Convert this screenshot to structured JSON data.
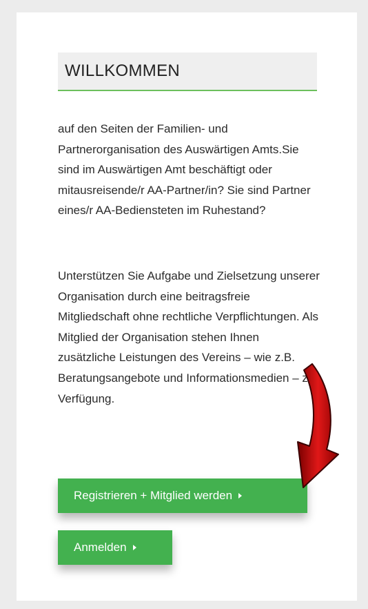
{
  "welcome": {
    "title": "WILLKOMMEN",
    "paragraph1": "auf den Seiten der Familien- und Partnerorganisation des Auswärtigen Amts.Sie sind im Auswärtigen Amt beschäftigt oder mitausreisende/r AA-Partner/in? Sie sind Partner eines/r AA-Bediensteten im Ruhestand?",
    "paragraph2": "Unterstützen Sie Aufgabe und Zielsetzung unserer Organisation durch eine beitragsfreie Mitgliedschaft ohne rechtliche Verpflichtungen. Als Mitglied der Organisation stehen Ihnen zusätzliche Leistungen des Vereins – wie z.B. Beratungsangebote und Informationsmedien – zur Verfügung."
  },
  "buttons": {
    "register_label": "Registrieren + Mitglied werden",
    "login_label": "Anmelden"
  },
  "icons": {
    "button_caret": "caret-right-icon",
    "annotation": "red-curved-arrow-icon"
  },
  "colors": {
    "accent_green": "#43b14f",
    "title_underline": "#6cbf5c",
    "arrow_red": "#d21414"
  }
}
